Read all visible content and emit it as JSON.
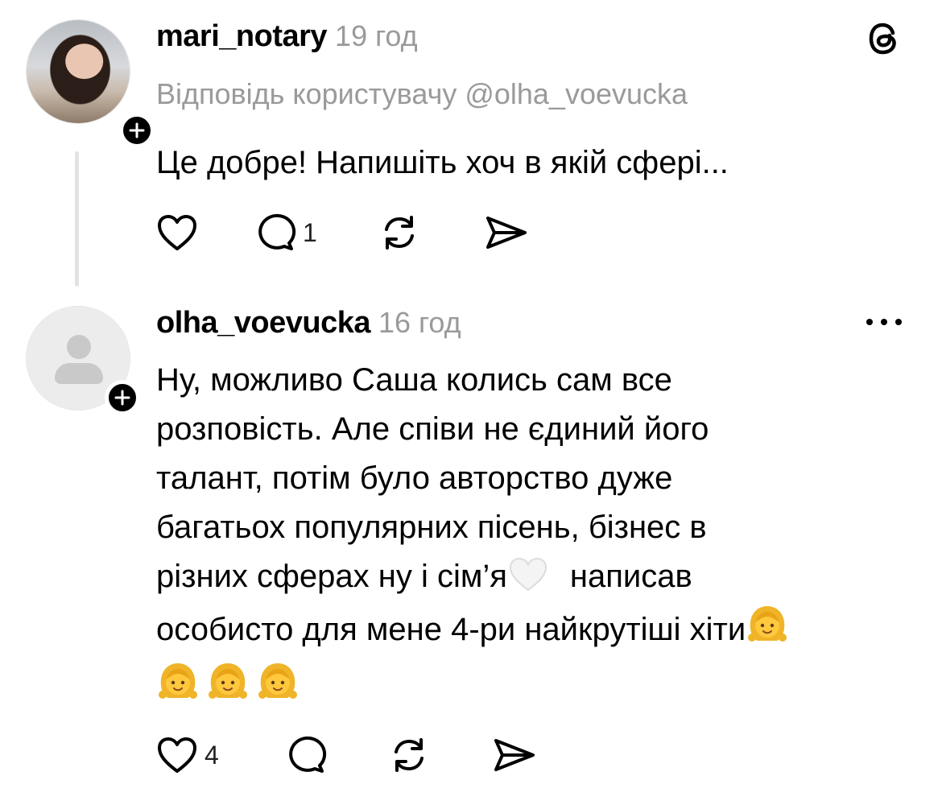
{
  "threads_logo": "threads-logo-icon",
  "posts": [
    {
      "username": "mari_notary",
      "time": "19 год",
      "reply_to": "Відповідь користувачу @olha_voevucka",
      "text": "Це добре! Напишіть хоч в якій сфері...",
      "comment_count": "1",
      "like_count": ""
    },
    {
      "username": "olha_voevucka",
      "time": "16 год",
      "lines": [
        "Ну, можливо Саша колись сам все",
        "розповість. Але співи не єдиний його",
        "талант, потім було авторство дуже",
        "багатьох популярних пісень, бізнес в"
      ],
      "line5a": "різних сферах ну і сім’я",
      "line5b": "написав",
      "line6": "особисто для мене 4-ри найкрутіші хіти",
      "like_count": "4",
      "comment_count": ""
    }
  ],
  "colors": {
    "muted": "#9a9a9a",
    "text": "#000000",
    "divider": "#e3e3e3"
  }
}
